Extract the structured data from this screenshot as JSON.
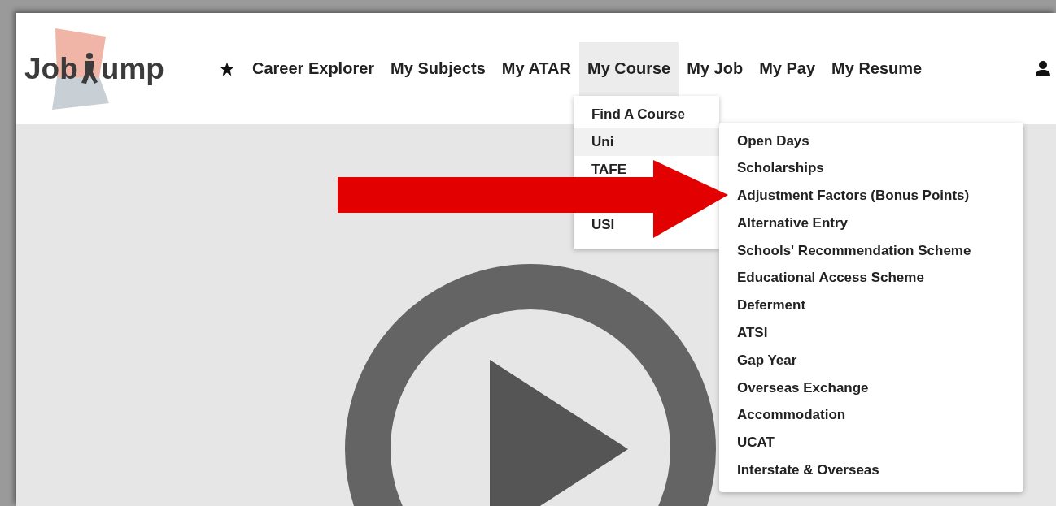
{
  "logo": {
    "before": "Job",
    "after": "ump"
  },
  "nav": [
    {
      "label": "Career Explorer",
      "selected": false
    },
    {
      "label": "My Subjects",
      "selected": false
    },
    {
      "label": "My ATAR",
      "selected": false
    },
    {
      "label": "My Course",
      "selected": true
    },
    {
      "label": "My Job",
      "selected": false
    },
    {
      "label": "My Pay",
      "selected": false
    },
    {
      "label": "My Resume",
      "selected": false
    }
  ],
  "course_menu": [
    {
      "label": "Find A Course",
      "selected": false
    },
    {
      "label": "Uni",
      "selected": true
    },
    {
      "label": "TAFE",
      "selected": false
    },
    {
      "label": "USI",
      "selected": false
    }
  ],
  "uni_submenu": [
    "Open Days",
    "Scholarships",
    "Adjustment Factors (Bonus Points)",
    "Alternative Entry",
    "Schools' Recommendation Scheme",
    "Educational Access Scheme",
    "Deferment",
    "ATSI",
    "Gap Year",
    "Overseas Exchange",
    "Accommodation",
    "UCAT",
    "Interstate & Overseas"
  ]
}
